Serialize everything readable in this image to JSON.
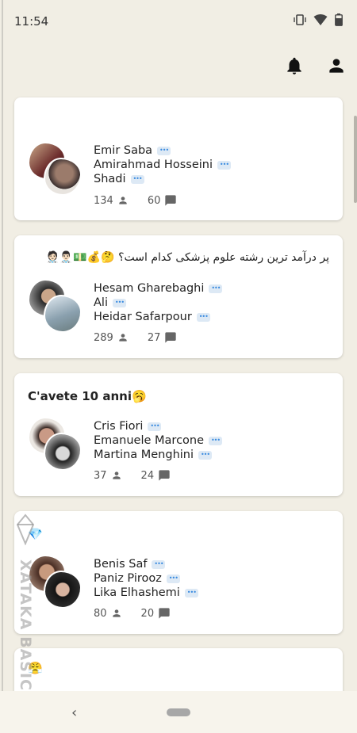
{
  "status": {
    "time": "11:54"
  },
  "cards": [
    {
      "title": "",
      "members": [
        "Emir Saba",
        "Amirahmad Hosseini",
        "Shadi"
      ],
      "members_count": "134",
      "messages_count": "60"
    },
    {
      "title": "پر درآمد ترین رشته علوم پزشکی کدام است؟ 🤔💰💵👨🏻‍⚕️🧑🏻‍⚕️",
      "members": [
        "Hesam Gharebaghi",
        "Ali",
        "Heidar Safarpour"
      ],
      "members_count": "289",
      "messages_count": "27"
    },
    {
      "title": "C'avete 10 anni🥱",
      "members": [
        "Cris Fiori",
        "Emanuele Marcone",
        "Martina Menghini"
      ],
      "members_count": "37",
      "messages_count": "24"
    },
    {
      "title": "💎",
      "members": [
        "Benis Saf",
        "Paniz Pirooz",
        "Lika Elhashemi"
      ],
      "members_count": "80",
      "messages_count": "20"
    },
    {
      "title": "😤"
    }
  ],
  "watermark": {
    "text": "XATAKA BASICS"
  },
  "colors": {
    "background": "#f1eee4",
    "card": "#ffffff",
    "badge": "#dde9f5"
  },
  "icons": [
    "vibrate-icon",
    "wifi-icon",
    "battery-icon",
    "bell-icon",
    "person-icon",
    "people-icon",
    "chat-icon",
    "back-icon",
    "home-pill-icon"
  ]
}
